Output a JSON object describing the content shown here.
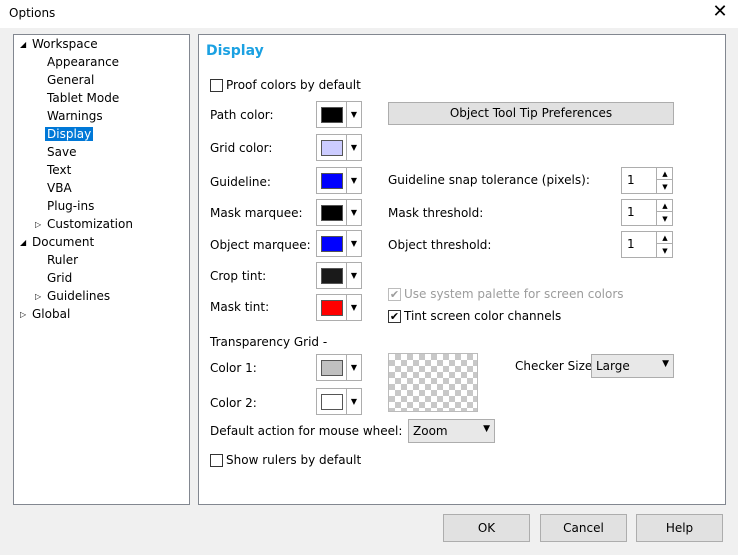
{
  "window": {
    "title": "Options",
    "close_glyph": "✕"
  },
  "tree": {
    "items": [
      {
        "label": "Workspace",
        "toggle": "◢"
      },
      {
        "label": "Appearance"
      },
      {
        "label": "General"
      },
      {
        "label": "Tablet Mode"
      },
      {
        "label": "Warnings"
      },
      {
        "label": "Display",
        "selected": true
      },
      {
        "label": "Save"
      },
      {
        "label": "Text"
      },
      {
        "label": "VBA"
      },
      {
        "label": "Plug-ins"
      },
      {
        "label": "Customization",
        "toggle": "▷"
      },
      {
        "label": "Document",
        "toggle": "◢"
      },
      {
        "label": "Ruler"
      },
      {
        "label": "Grid"
      },
      {
        "label": "Guidelines",
        "toggle": "▷"
      },
      {
        "label": "Global",
        "toggle": "▷"
      }
    ]
  },
  "display": {
    "title": "Display",
    "proof_colors": {
      "label": "Proof colors by default",
      "checked": false
    },
    "colors": {
      "path": {
        "label": "Path color:",
        "swatch": "#000000"
      },
      "grid": {
        "label": "Grid color:",
        "swatch": "#ccccff"
      },
      "guideline": {
        "label": "Guideline:",
        "swatch": "#0000ff"
      },
      "mask_marquee": {
        "label": "Mask marquee:",
        "swatch": "#000000"
      },
      "object_marquee": {
        "label": "Object marquee:",
        "swatch": "#0000ff"
      },
      "crop_tint": {
        "label": "Crop tint:",
        "swatch": "#1a1a1a"
      },
      "mask_tint": {
        "label": "Mask tint:",
        "swatch": "#ff0000"
      }
    },
    "object_tooltip_button": "Object Tool Tip Preferences",
    "guideline_snap": {
      "label": "Guideline snap tolerance (pixels):",
      "value": "1"
    },
    "mask_threshold": {
      "label": "Mask threshold:",
      "value": "1"
    },
    "object_threshold": {
      "label": "Object threshold:",
      "value": "1"
    },
    "use_system_palette": {
      "label": "Use system palette for screen colors",
      "checked": true,
      "disabled": true,
      "mark": "✔"
    },
    "tint_screen": {
      "label": "Tint screen color channels",
      "checked": true,
      "mark": "✔"
    },
    "transparency_grid": {
      "label": "Transparency Grid -",
      "color1": {
        "label": "Color 1:",
        "swatch": "#c0c0c0"
      },
      "color2": {
        "label": "Color 2:",
        "swatch": "#ffffff"
      },
      "checker_size": {
        "label": "Checker Size:",
        "value": "Large"
      }
    },
    "mouse_wheel": {
      "label": "Default action for mouse wheel:",
      "value": "Zoom"
    },
    "show_rulers": {
      "label": "Show rulers by default",
      "checked": false
    }
  },
  "footer": {
    "ok": "OK",
    "cancel": "Cancel",
    "help": "Help"
  },
  "glyphs": {
    "dropdown": "▼",
    "spin_up": "▲",
    "spin_down": "▼"
  }
}
